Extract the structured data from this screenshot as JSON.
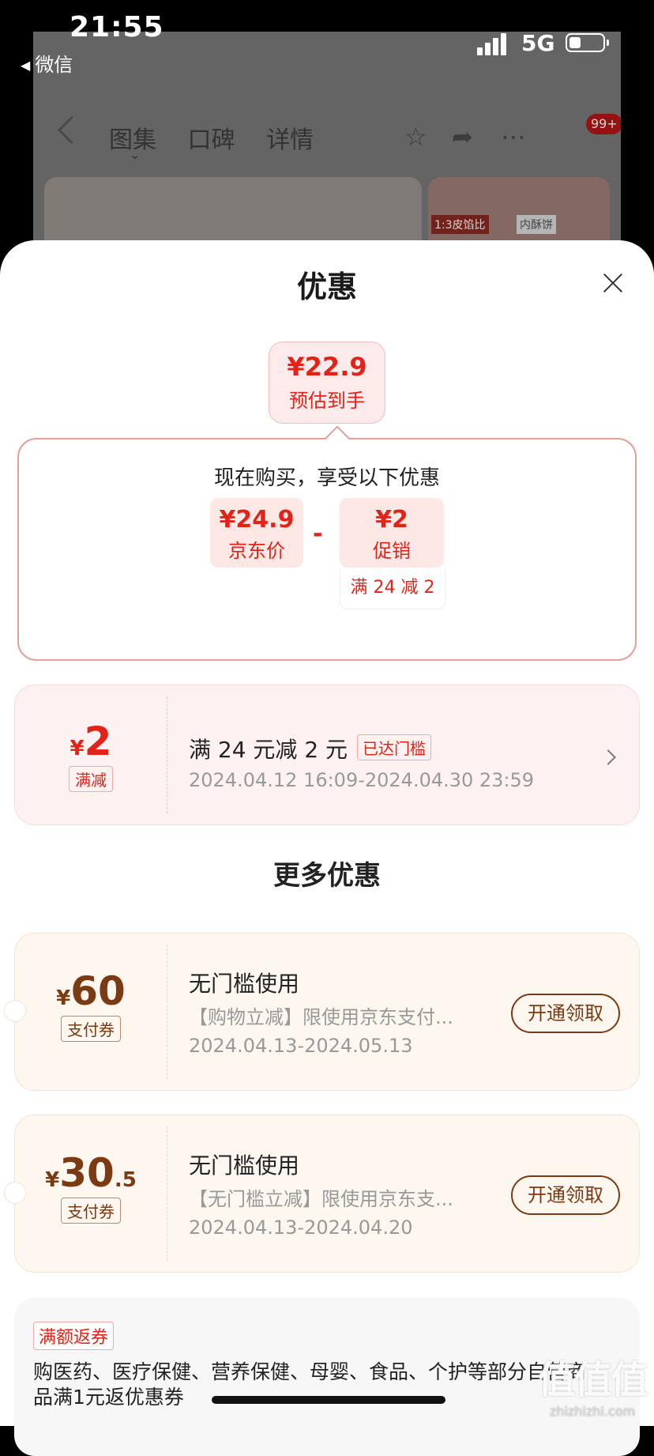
{
  "status_bar": {
    "time": "21:55",
    "back_app": "微信",
    "network": "5G",
    "battery_level": 0.35
  },
  "underlying_page": {
    "tabs": [
      "图集",
      "口碑",
      "详情"
    ],
    "badge": "99+",
    "product_tag_1": "1:3皮馅比",
    "product_tag_2": "内酥饼"
  },
  "sheet": {
    "title": "优惠",
    "estimate": {
      "price": "¥22.9",
      "label": "预估到手"
    },
    "breakdown": {
      "title": "现在购买，享受以下优惠",
      "jd_price": {
        "value": "¥24.9",
        "label": "京东价"
      },
      "operator": "-",
      "promo": {
        "value": "¥2",
        "label": "促销"
      },
      "promo_rule": "满 24 减 2"
    },
    "main_coupon": {
      "currency": "¥",
      "amount": "2",
      "tag": "满减",
      "title": "满 24 元减 2 元",
      "badge": "已达门槛",
      "validity": "2024.04.12 16:09-2024.04.30 23:59"
    },
    "more_title": "更多优惠",
    "more_coupons": [
      {
        "currency": "¥",
        "amount": "60",
        "amount_decimal": "",
        "tag": "支付券",
        "title": "无门槛使用",
        "desc": "【购物立减】限使用京东支付...",
        "validity": "2024.04.13-2024.05.13",
        "button": "开通领取"
      },
      {
        "currency": "¥",
        "amount": "30",
        "amount_decimal": ".5",
        "tag": "支付券",
        "title": "无门槛使用",
        "desc": "【无门槛立减】限使用京东支...",
        "validity": "2024.04.13-2024.04.20",
        "button": "开通领取"
      }
    ],
    "rebate": {
      "tag": "满额返券",
      "text": "购医药、医疗保健、营养保健、母婴、食品、个护等部分自营商品满1元返优惠券"
    }
  },
  "watermark": {
    "main": "值值值",
    "url": "zhizhizhi.com"
  },
  "colors": {
    "accent_red": "#e2231a",
    "brown": "#7a3a12",
    "sheet_bg": "#ffffff"
  }
}
